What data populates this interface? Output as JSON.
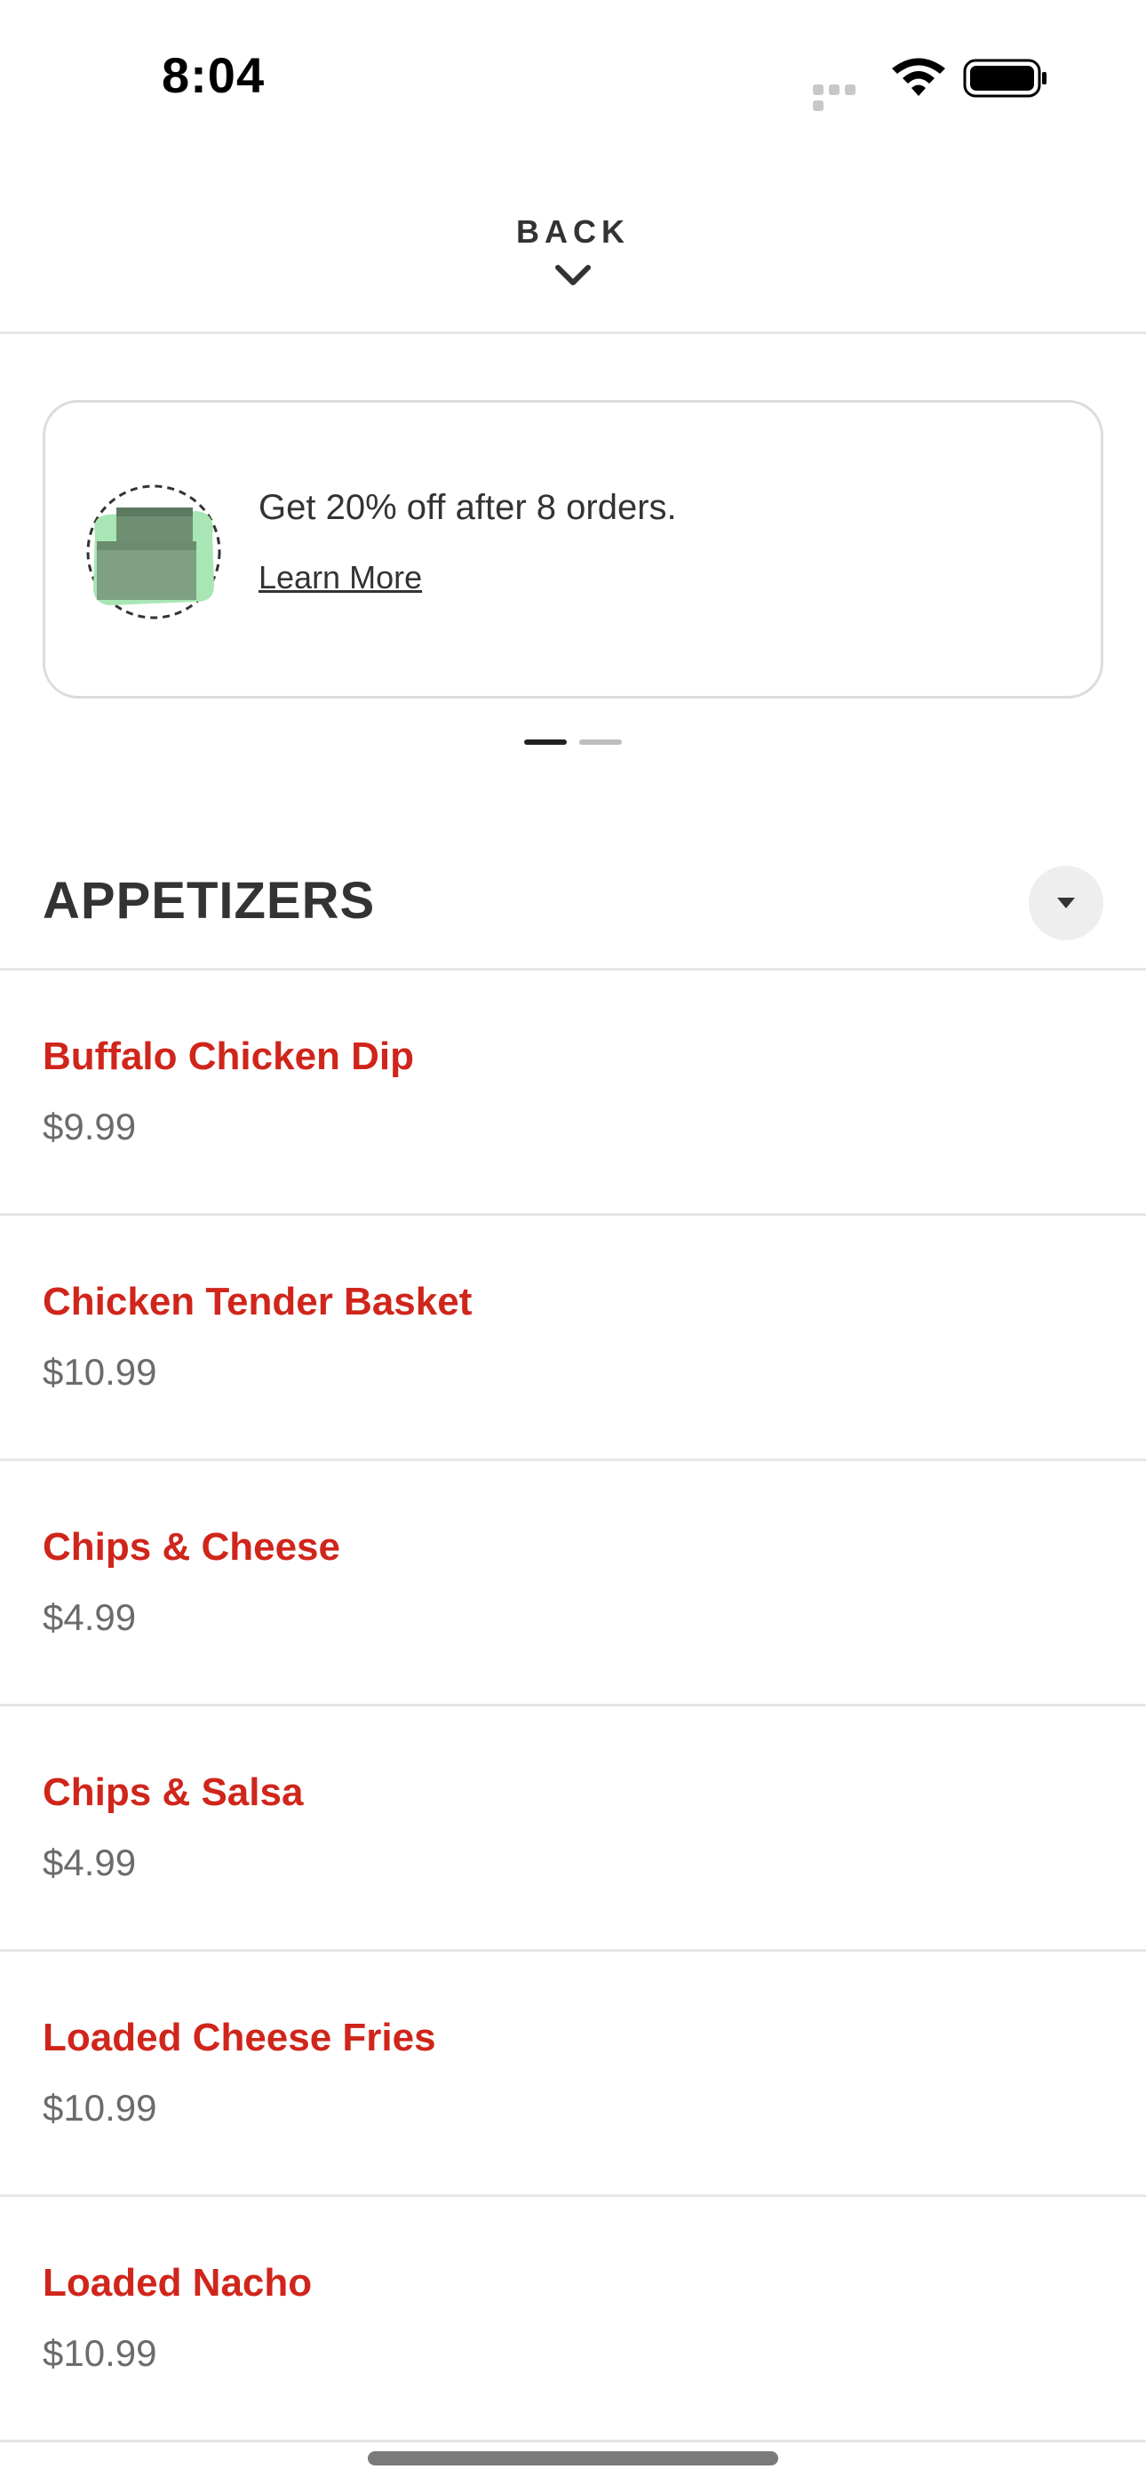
{
  "status_bar": {
    "time": "8:04"
  },
  "header": {
    "back_label": "BACK"
  },
  "promo": {
    "text": "Get 20% off after 8 orders.",
    "link": "Learn More",
    "accent_color": "#a8e6b5"
  },
  "section": {
    "title": "APPETIZERS"
  },
  "menu_items": [
    {
      "name": "Buffalo Chicken Dip",
      "price": "$9.99"
    },
    {
      "name": "Chicken Tender Basket",
      "price": "$10.99"
    },
    {
      "name": "Chips & Cheese",
      "price": "$4.99"
    },
    {
      "name": "Chips & Salsa",
      "price": "$4.99"
    },
    {
      "name": "Loaded Cheese Fries",
      "price": "$10.99"
    },
    {
      "name": "Loaded Nacho",
      "price": "$10.99"
    }
  ],
  "colors": {
    "item_name": "#d0251b",
    "price": "#6b6b6b",
    "text": "#333333"
  }
}
